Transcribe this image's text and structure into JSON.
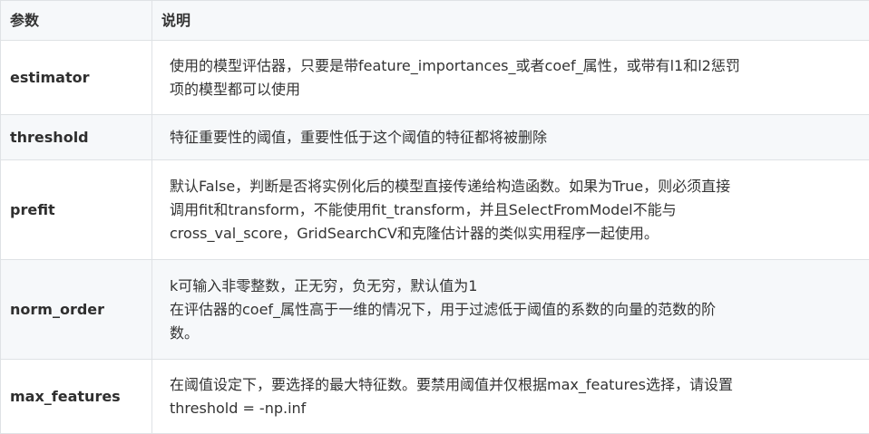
{
  "table": {
    "headers": [
      "参数",
      "说明"
    ],
    "rows": [
      {
        "param": "estimator",
        "lines": [
          "使用的模型评估器，只要是带feature_importances_或者coef_属性，或带有l1和l2惩罚",
          "项的模型都可以使用"
        ]
      },
      {
        "param": "threshold",
        "lines": [
          "特征重要性的阈值，重要性低于这个阈值的特征都将被删除"
        ]
      },
      {
        "param": "prefit",
        "lines": [
          "默认False，判断是否将实例化后的模型直接传递给构造函数。如果为True，则必须直接",
          "调用fit和transform，不能使用fit_transform，并且SelectFromModel不能与",
          "cross_val_score，GridSearchCV和克隆估计器的类似实用程序一起使用。"
        ]
      },
      {
        "param": "norm_order",
        "lines": [
          "k可输入非零整数，正无穷，负无穷，默认值为1",
          "在评估器的coef_属性高于一维的情况下，用于过滤低于阈值的系数的向量的范数的阶",
          "数。"
        ]
      },
      {
        "param": "max_features",
        "lines": [
          "在阈值设定下，要选择的最大特征数。要禁用阈值并仅根据max_features选择，请设置",
          "threshold = -np.inf"
        ]
      }
    ]
  }
}
